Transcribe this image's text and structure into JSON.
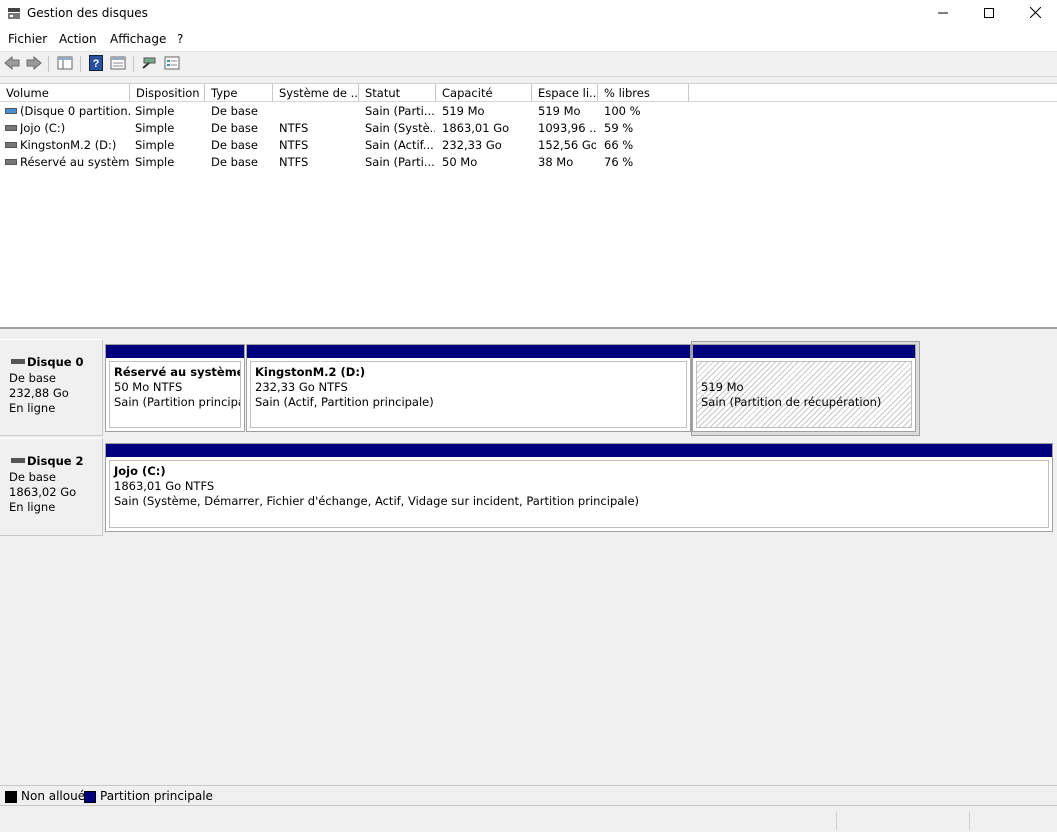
{
  "window": {
    "title": "Gestion des disques",
    "icons": [
      "disk-management-app-icon",
      "minimize-icon",
      "maximize-icon",
      "close-icon"
    ]
  },
  "menu": [
    "Fichier",
    "Action",
    "Affichage",
    "?"
  ],
  "toolbar": {
    "icons": [
      "back-arrow-icon",
      "forward-arrow-icon",
      "console-tree-icon",
      "help-icon",
      "properties-icon",
      "rescan-icon",
      "disk-list-icon"
    ]
  },
  "volume_list": {
    "columns": [
      "Volume",
      "Disposition",
      "Type",
      "Système de ...",
      "Statut",
      "Capacité",
      "Espace li...",
      "% libres"
    ],
    "rows": [
      [
        "(Disque 0 partition...",
        "Simple",
        "De base",
        "",
        "Sain (Parti...",
        "519 Mo",
        "519 Mo",
        "100 %"
      ],
      [
        "Jojo (C:)",
        "Simple",
        "De base",
        "NTFS",
        "Sain (Systè...",
        "1863,01 Go",
        "1093,96 ...",
        "59 %"
      ],
      [
        "KingstonM.2 (D:)",
        "Simple",
        "De base",
        "NTFS",
        "Sain (Actif...",
        "232,33 Go",
        "152,56 Go",
        "66 %"
      ],
      [
        "Réservé au systèm...",
        "Simple",
        "De base",
        "NTFS",
        "Sain (Parti...",
        "50 Mo",
        "38 Mo",
        "76 %"
      ]
    ]
  },
  "disks": [
    {
      "name": "Disque 0",
      "type": "De base",
      "size": "232,88 Go",
      "status": "En ligne",
      "partitions": [
        {
          "title": "Réservé au système  (E",
          "line2": "50 Mo NTFS",
          "line3": "Sain (Partition principale"
        },
        {
          "title": "KingstonM.2  (D:)",
          "line2": "232,33 Go NTFS",
          "line3": "Sain (Actif, Partition principale)"
        },
        {
          "title": "",
          "line2": "519 Mo",
          "line3": "Sain (Partition de récupération)"
        }
      ]
    },
    {
      "name": "Disque 2",
      "type": "De base",
      "size": "1863,02 Go",
      "status": "En ligne",
      "partitions": [
        {
          "title": "Jojo  (C:)",
          "line2": "1863,01 Go NTFS",
          "line3": "Sain (Système, Démarrer, Fichier d'échange, Actif, Vidage sur incident, Partition principale)"
        }
      ]
    }
  ],
  "legend": [
    {
      "label": "Non alloué",
      "color": "#000000"
    },
    {
      "label": "Partition principale",
      "color": "#00007f"
    }
  ],
  "colors": {
    "partition_bar": "#00007f",
    "unallocated": "#000000"
  }
}
